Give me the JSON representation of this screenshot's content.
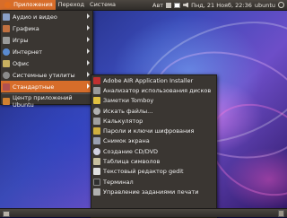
{
  "top_panel": {
    "menus": [
      {
        "label": "Приложения",
        "active": true
      },
      {
        "label": "Переход",
        "active": false
      },
      {
        "label": "Система",
        "active": false
      }
    ],
    "tray": {
      "keyboard_layout": "Авт",
      "datetime": "Пнд, 21 Нояб, 22:36",
      "user": "ubuntu"
    }
  },
  "applications_menu": {
    "items": [
      {
        "label": "Аудио и видео",
        "icon": "audio-video-icon",
        "color": "#8aa0c8",
        "has_submenu": true
      },
      {
        "label": "Графика",
        "icon": "graphics-icon",
        "color": "#c07040",
        "has_submenu": true
      },
      {
        "label": "Игры",
        "icon": "games-icon",
        "color": "#9a9a9a",
        "has_submenu": true
      },
      {
        "label": "Интернет",
        "icon": "internet-icon",
        "color": "#5a8ad0",
        "has_submenu": true
      },
      {
        "label": "Офис",
        "icon": "office-icon",
        "color": "#c8b060",
        "has_submenu": true
      },
      {
        "label": "Системные утилиты",
        "icon": "system-tools-icon",
        "color": "#8a8a8a",
        "has_submenu": true
      },
      {
        "label": "Стандартные",
        "icon": "accessories-icon",
        "color": "#b05050",
        "has_submenu": true,
        "highlighted": true
      },
      {
        "label": "Центр приложений Ubuntu",
        "icon": "software-center-icon",
        "color": "#d08030",
        "has_submenu": false
      }
    ]
  },
  "accessories_submenu": {
    "items": [
      {
        "label": "Adobe AIR Application Installer",
        "icon": "adobe-air-icon",
        "color": "#c03030"
      },
      {
        "label": "Анализатор использования дисков",
        "icon": "disk-usage-icon",
        "color": "#9a9a9a"
      },
      {
        "label": "Заметки Tomboy",
        "icon": "tomboy-notes-icon",
        "color": "#e0c040"
      },
      {
        "label": "Искать файлы...",
        "icon": "search-files-icon",
        "color": "#b0b0b0"
      },
      {
        "label": "Калькулятор",
        "icon": "calculator-icon",
        "color": "#a0a0a0"
      },
      {
        "label": "Пароли и ключи шифрования",
        "icon": "passwords-keys-icon",
        "color": "#d0b040"
      },
      {
        "label": "Снимок экрана",
        "icon": "screenshot-icon",
        "color": "#9aa0b0"
      },
      {
        "label": "Создание CD/DVD",
        "icon": "cd-dvd-icon",
        "color": "#d0d0e0"
      },
      {
        "label": "Таблица символов",
        "icon": "character-map-icon",
        "color": "#c8c0a0"
      },
      {
        "label": "Текстовый редактор gedit",
        "icon": "gedit-icon",
        "color": "#e0e0e0"
      },
      {
        "label": "Терминал",
        "icon": "terminal-icon",
        "color": "#303030"
      },
      {
        "label": "Управление заданиями печати",
        "icon": "print-jobs-icon",
        "color": "#b0b0b0"
      }
    ]
  }
}
